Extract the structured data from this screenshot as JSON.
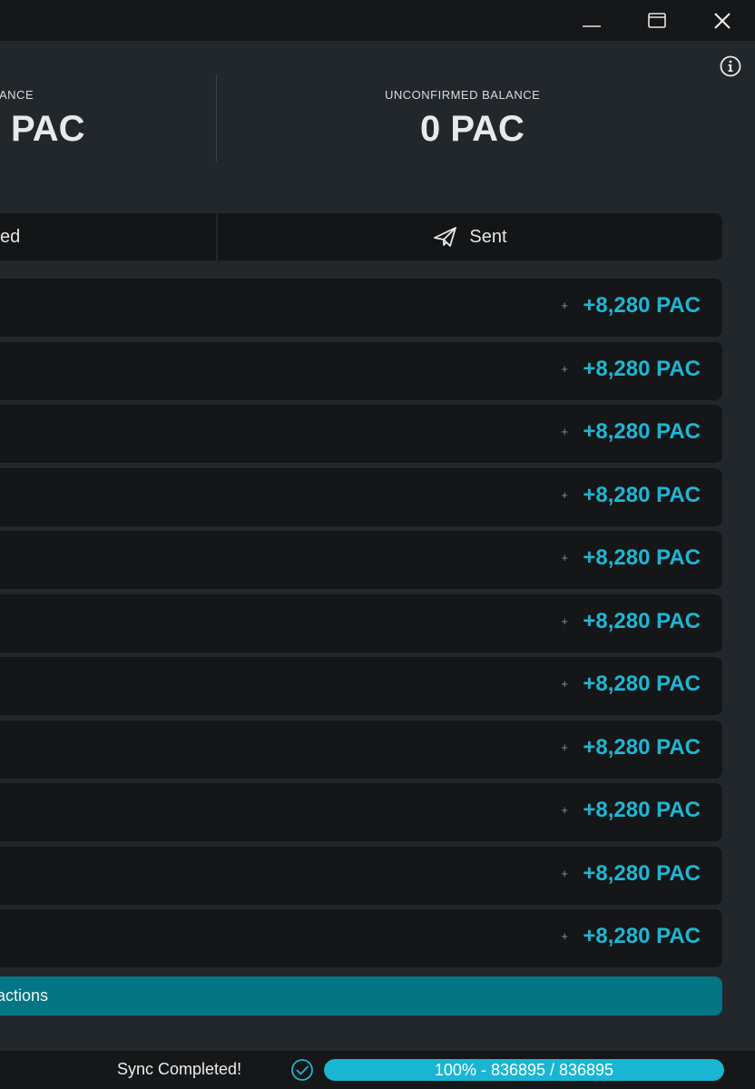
{
  "window_controls": {
    "minimize_icon": "minimize-icon",
    "maximize_icon": "maximize-icon",
    "close_icon": "close-icon"
  },
  "info_icon": "info-icon",
  "balances": {
    "confirmed_label": "ANCE",
    "confirmed_value": "PAC",
    "unconfirmed_label": "UNCONFIRMED BALANCE",
    "unconfirmed_value": "0 PAC"
  },
  "tabs": {
    "received_label": "ed",
    "sent_label": "Sent",
    "sent_icon": "paper-plane-icon"
  },
  "transactions": [
    {
      "sign": "+",
      "amount": "+8,280 PAC"
    },
    {
      "sign": "+",
      "amount": "+8,280 PAC"
    },
    {
      "sign": "+",
      "amount": "+8,280 PAC"
    },
    {
      "sign": "+",
      "amount": "+8,280 PAC"
    },
    {
      "sign": "+",
      "amount": "+8,280 PAC"
    },
    {
      "sign": "+",
      "amount": "+8,280 PAC"
    },
    {
      "sign": "+",
      "amount": "+8,280 PAC"
    },
    {
      "sign": "+",
      "amount": "+8,280 PAC"
    },
    {
      "sign": "+",
      "amount": "+8,280 PAC"
    },
    {
      "sign": "+",
      "amount": "+8,280 PAC"
    },
    {
      "sign": "+",
      "amount": "+8,280 PAC"
    }
  ],
  "all_transactions_button": "sactions",
  "status": {
    "sync_text": "Sync Completed!",
    "sync_icon": "check-circle-icon",
    "progress_fraction": 1.0,
    "progress_text": "100% - 836895 / 836895"
  },
  "colors": {
    "accent": "#1fb6d2",
    "button": "#027684",
    "background": "#22272c",
    "row": "#141618"
  }
}
